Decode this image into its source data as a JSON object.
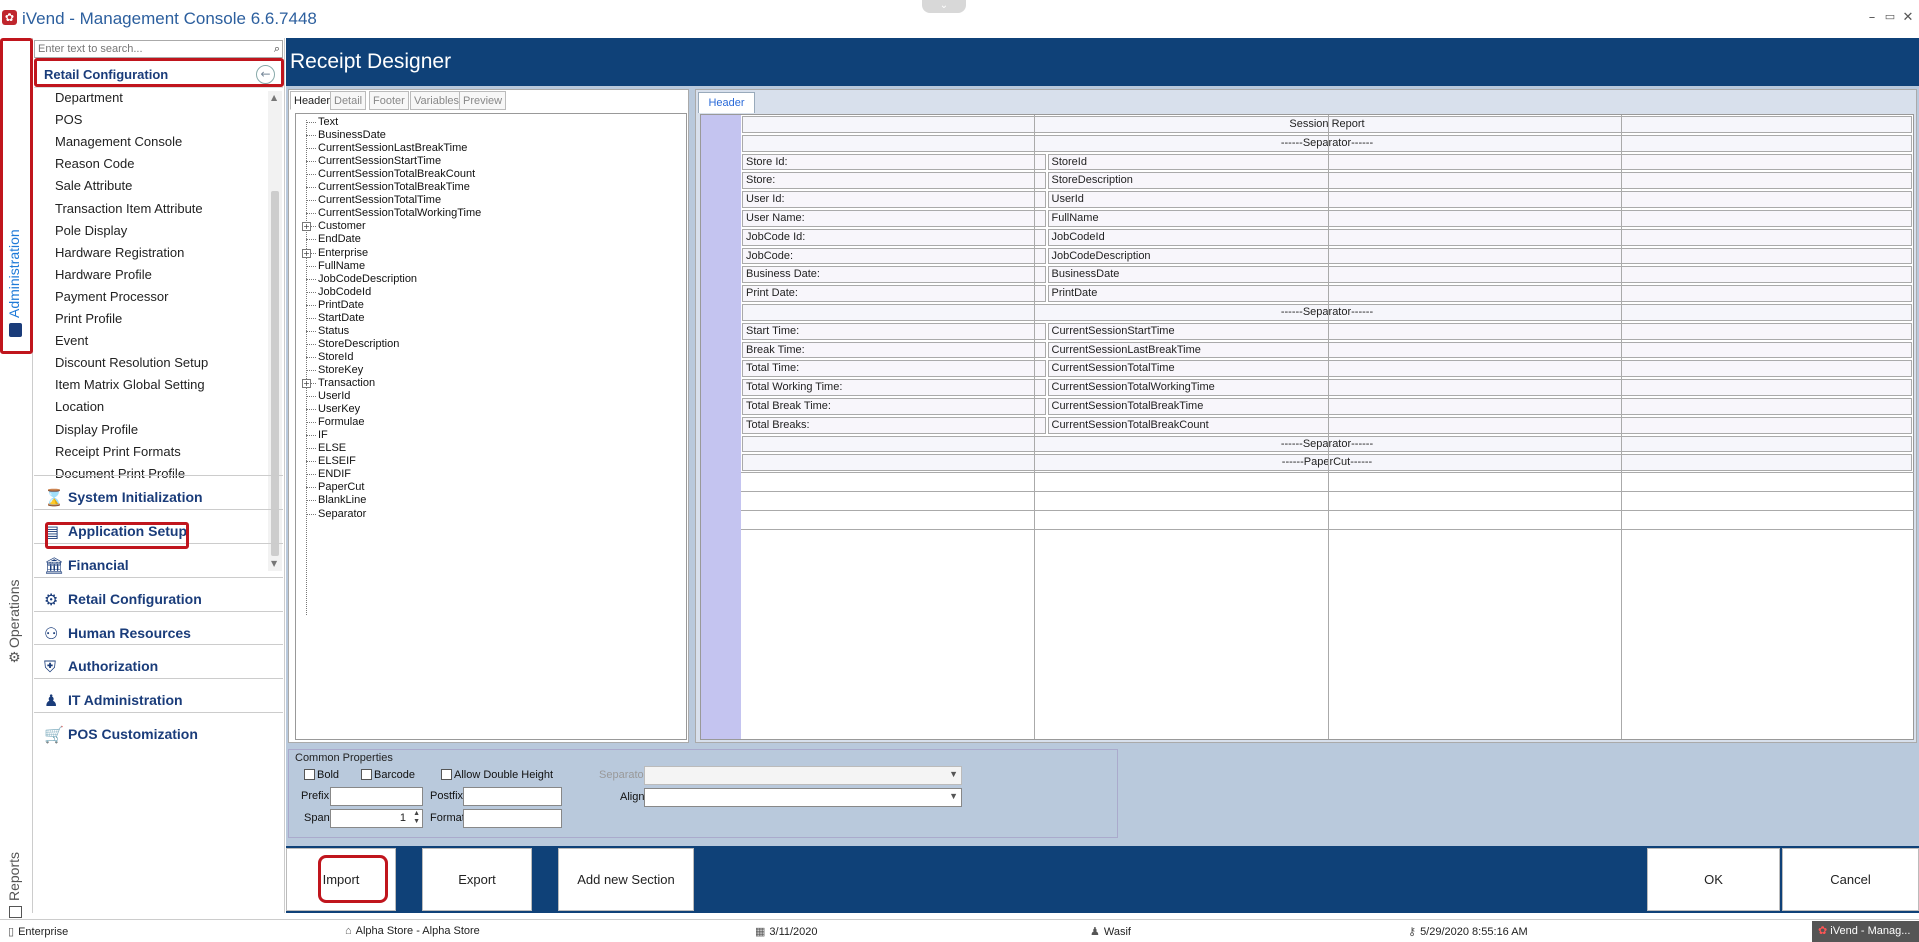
{
  "window": {
    "title": "iVend - Management Console  6.6.7448",
    "minimize": "–",
    "restore": "▭",
    "close": "✕"
  },
  "vertical_tabs": {
    "administration": "Administration",
    "operations": "Operations",
    "reports": "Reports"
  },
  "nav": {
    "search_placeholder": "Enter text to search...",
    "section_title": "Retail Configuration",
    "items": [
      "Department",
      "POS",
      "Management Console",
      "Reason Code",
      "Sale Attribute",
      "Transaction Item Attribute",
      "Pole Display",
      "Hardware Registration",
      "Hardware Profile",
      "Payment Processor",
      "Print Profile",
      "Event",
      "Discount Resolution Setup",
      "Item Matrix Global Setting",
      "Location",
      "Display Profile",
      "Receipt Print Formats",
      "Document Print Profile"
    ],
    "groups": [
      "System Initialization",
      "Application Setup",
      "Financial",
      "Retail Configuration",
      "Human Resources",
      "Authorization",
      "IT Administration",
      "POS Customization"
    ]
  },
  "designer": {
    "title": "Receipt Designer",
    "left_tabs": [
      "Header",
      "Detail",
      "Footer",
      "Variables",
      "Preview"
    ],
    "tree": [
      {
        "label": "Text",
        "expandable": false
      },
      {
        "label": "BusinessDate",
        "expandable": false
      },
      {
        "label": "CurrentSessionLastBreakTime",
        "expandable": false
      },
      {
        "label": "CurrentSessionStartTime",
        "expandable": false
      },
      {
        "label": "CurrentSessionTotalBreakCount",
        "expandable": false
      },
      {
        "label": "CurrentSessionTotalBreakTime",
        "expandable": false
      },
      {
        "label": "CurrentSessionTotalTime",
        "expandable": false
      },
      {
        "label": "CurrentSessionTotalWorkingTime",
        "expandable": false
      },
      {
        "label": "Customer",
        "expandable": true
      },
      {
        "label": "EndDate",
        "expandable": false
      },
      {
        "label": "Enterprise",
        "expandable": true
      },
      {
        "label": "FullName",
        "expandable": false
      },
      {
        "label": "JobCodeDescription",
        "expandable": false
      },
      {
        "label": "JobCodeId",
        "expandable": false
      },
      {
        "label": "PrintDate",
        "expandable": false
      },
      {
        "label": "StartDate",
        "expandable": false
      },
      {
        "label": "Status",
        "expandable": false
      },
      {
        "label": "StoreDescription",
        "expandable": false
      },
      {
        "label": "StoreId",
        "expandable": false
      },
      {
        "label": "StoreKey",
        "expandable": false
      },
      {
        "label": "Transaction",
        "expandable": true
      },
      {
        "label": "UserId",
        "expandable": false
      },
      {
        "label": "UserKey",
        "expandable": false
      },
      {
        "label": "Formulae",
        "expandable": false
      },
      {
        "label": "IF",
        "expandable": false
      },
      {
        "label": "ELSE",
        "expandable": false
      },
      {
        "label": "ELSEIF",
        "expandable": false
      },
      {
        "label": "ENDIF",
        "expandable": false
      },
      {
        "label": "PaperCut",
        "expandable": false
      },
      {
        "label": "BlankLine",
        "expandable": false
      },
      {
        "label": "Separator",
        "expandable": false
      }
    ],
    "right_tab": "Header",
    "grid_rows": [
      {
        "type": "span",
        "text": "Session Report"
      },
      {
        "type": "span",
        "text": "------Separator------"
      },
      {
        "type": "kv",
        "label": "Store Id:",
        "value": "StoreId"
      },
      {
        "type": "kv",
        "label": "Store:",
        "value": "StoreDescription"
      },
      {
        "type": "kv",
        "label": "User Id:",
        "value": "UserId"
      },
      {
        "type": "kv",
        "label": "User Name:",
        "value": "FullName"
      },
      {
        "type": "kv",
        "label": "JobCode Id:",
        "value": "JobCodeId"
      },
      {
        "type": "kv",
        "label": "JobCode:",
        "value": "JobCodeDescription"
      },
      {
        "type": "kv",
        "label": "Business Date:",
        "value": "BusinessDate"
      },
      {
        "type": "kv",
        "label": "Print Date:",
        "value": "PrintDate"
      },
      {
        "type": "span",
        "text": "------Separator------"
      },
      {
        "type": "kv",
        "label": "Start Time:",
        "value": "CurrentSessionStartTime"
      },
      {
        "type": "kv",
        "label": "Break Time:",
        "value": "CurrentSessionLastBreakTime"
      },
      {
        "type": "kv",
        "label": "Total Time:",
        "value": "CurrentSessionTotalTime"
      },
      {
        "type": "kv",
        "label": "Total Working Time:",
        "value": "CurrentSessionTotalWorkingTime"
      },
      {
        "type": "kv",
        "label": "Total Break Time:",
        "value": "CurrentSessionTotalBreakTime"
      },
      {
        "type": "kv",
        "label": "Total Breaks:",
        "value": "CurrentSessionTotalBreakCount"
      },
      {
        "type": "span",
        "text": "------Separator------"
      },
      {
        "type": "span",
        "text": "------PaperCut------"
      }
    ],
    "common": {
      "title": "Common Properties",
      "bold": "Bold",
      "barcode": "Barcode",
      "allow_double_height": "Allow Double Height",
      "prefix": "Prefix",
      "postfix": "Postfix",
      "span": "Span",
      "span_value": "1",
      "format": "Format",
      "separator": "Separator",
      "align": "Align"
    },
    "buttons": {
      "import": "Import",
      "export": "Export",
      "add_section": "Add new Section",
      "ok": "OK",
      "cancel": "Cancel"
    }
  },
  "status": {
    "company": "Enterprise",
    "store": "Alpha Store - Alpha Store",
    "business_date": "3/11/2020",
    "user": "Wasif",
    "login_time": "5/29/2020 8:55:16 AM",
    "task_label": "iVend - Manag..."
  },
  "colors": {
    "header_blue": "#0f4178",
    "panel_bg": "#b9c9dc",
    "highlight_red": "#c0151d",
    "grid_left_col": "#c4c4f0"
  }
}
